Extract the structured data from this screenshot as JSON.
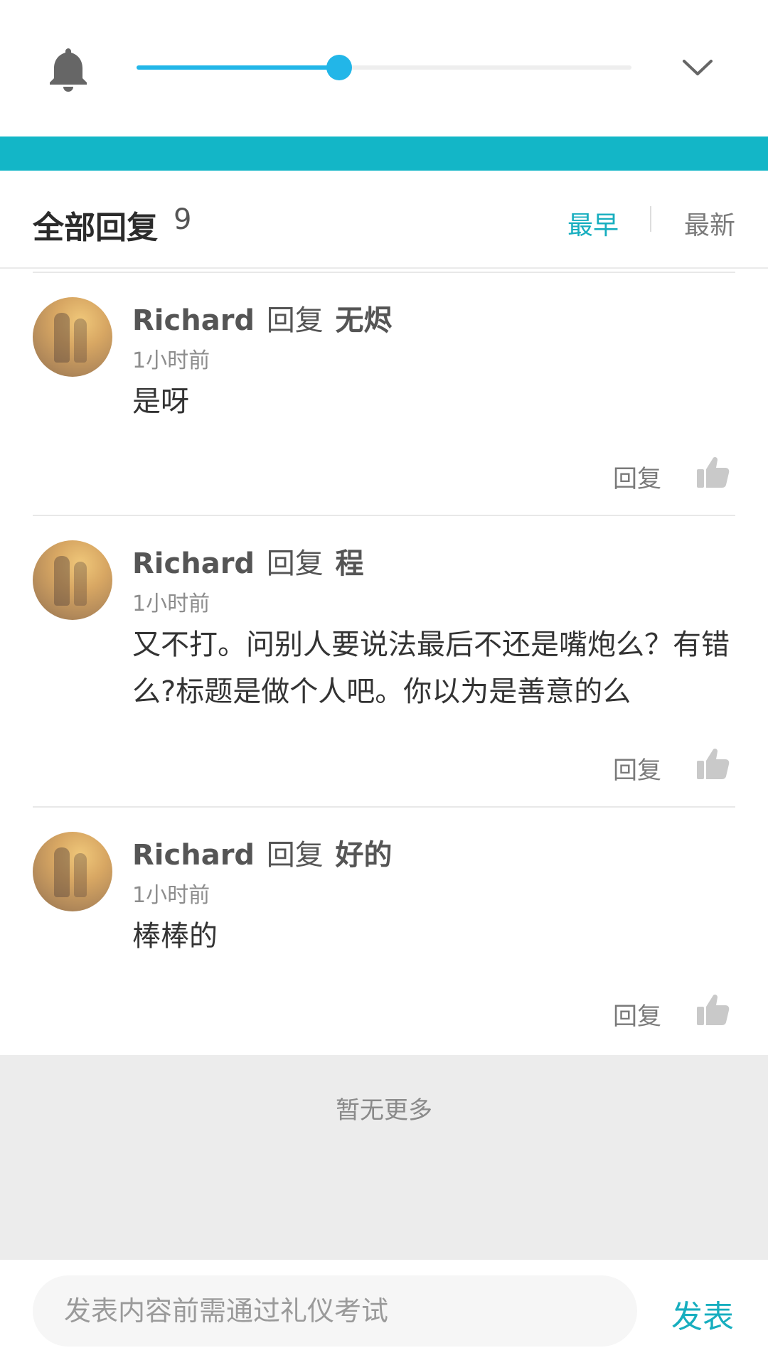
{
  "colors": {
    "accent": "#17aebf",
    "slider": "#22b6e8",
    "band": "#13b6c7"
  },
  "top": {
    "bell_icon": "bell-icon",
    "slider_value": 0.41,
    "collapse_icon": "chevron-down-icon"
  },
  "header": {
    "title": "全部回复",
    "count": "9",
    "sort_earliest": "最早",
    "sort_latest": "最新"
  },
  "comments": [
    {
      "user": "Richard",
      "verb": "回复",
      "target": "无烬",
      "time": "1小时前",
      "text": "是呀",
      "reply_label": "回复",
      "like_icon": "thumbs-up-icon"
    },
    {
      "user": "Richard",
      "verb": "回复",
      "target": "程",
      "time": "1小时前",
      "text": "又不打。问别人要说法最后不还是嘴炮么？有错么?标题是做个人吧。你以为是善意的么",
      "reply_label": "回复",
      "like_icon": "thumbs-up-icon"
    },
    {
      "user": "Richard",
      "verb": "回复",
      "target": "好的",
      "time": "1小时前",
      "text": "棒棒的",
      "reply_label": "回复",
      "like_icon": "thumbs-up-icon"
    }
  ],
  "footer": {
    "no_more": "暂无更多",
    "input_placeholder": "发表内容前需通过礼仪考试",
    "publish_label": "发表"
  }
}
